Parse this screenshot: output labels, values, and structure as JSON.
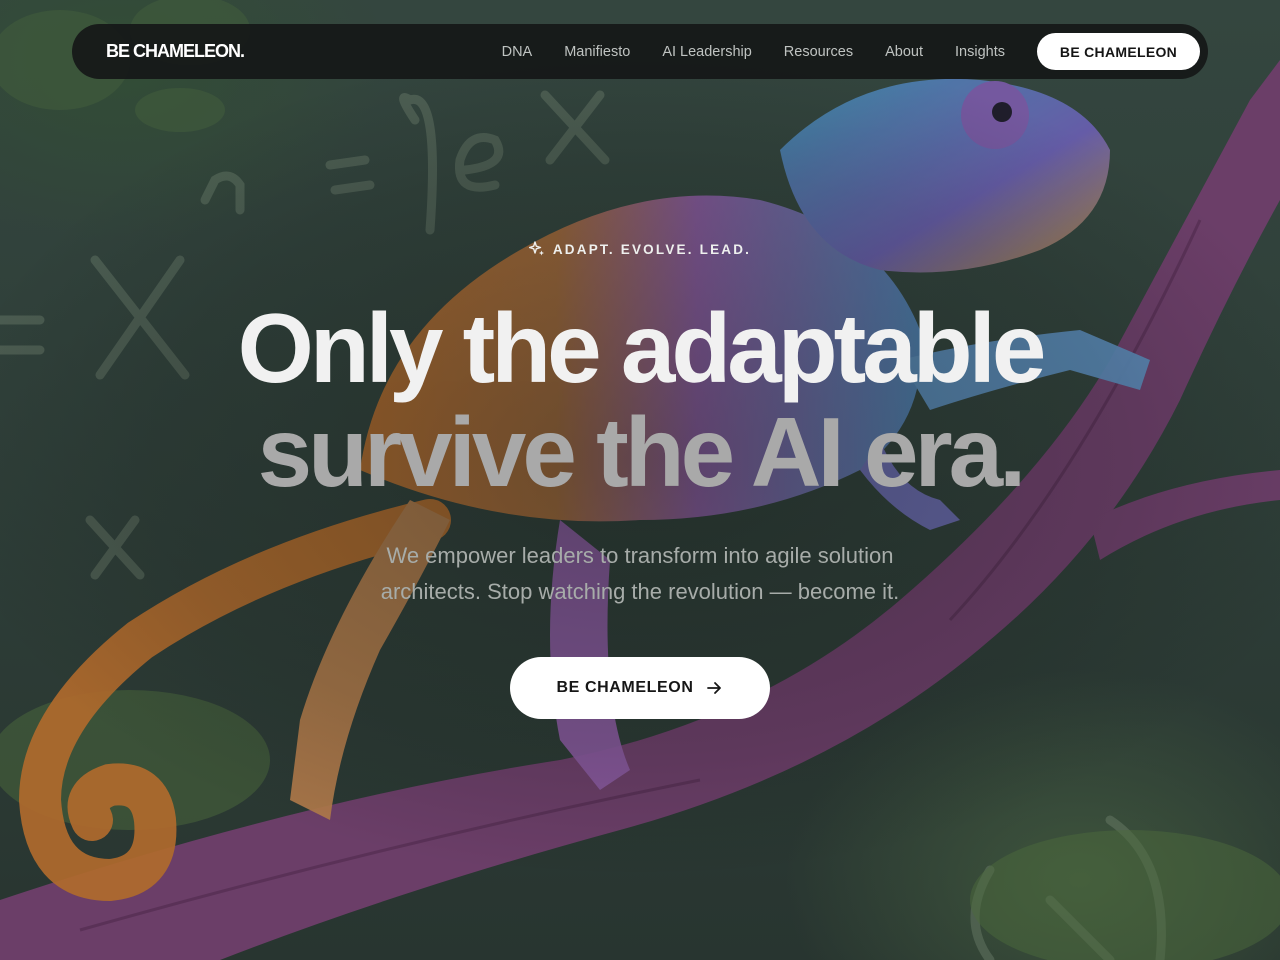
{
  "nav": {
    "logo": "BE CHAMELEON.",
    "links": [
      {
        "label": "DNA"
      },
      {
        "label": "Manifiesto"
      },
      {
        "label": "AI Leadership"
      },
      {
        "label": "Resources"
      },
      {
        "label": "About"
      },
      {
        "label": "Insights"
      }
    ],
    "cta_label": "BE CHAMELEON"
  },
  "hero": {
    "tagline": "ADAPT. EVOLVE. LEAD.",
    "tagline_icon": "sparkle-icon",
    "headline_line1": "Only the adaptable",
    "headline_line2": "survive the AI era.",
    "subtext": "We empower leaders to transform into agile solution architects. Stop watching the revolution — become it.",
    "cta_label": "BE CHAMELEON",
    "cta_icon": "arrow-right-icon",
    "background_image": "chameleon-on-branch-image"
  },
  "colors": {
    "background": "#2f3f39",
    "nav_background": "#161818",
    "accent_button": "#ffffff",
    "headline_primary": "#f1f1f1",
    "headline_secondary": "#a9a9a9"
  }
}
